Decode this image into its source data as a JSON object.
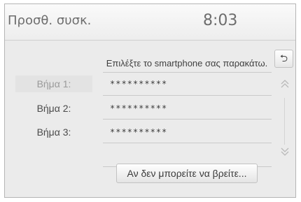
{
  "header": {
    "title": "Προσθ. συσκ.",
    "clock": "8:03"
  },
  "instruction": "Επιλέξτε το smartphone σας παρακάτω.",
  "back_icon_glyph": "⮌",
  "steps": [
    {
      "label": "Βήμα 1:",
      "value": "**********",
      "active": true
    },
    {
      "label": "Βήμα 2:",
      "value": "**********",
      "active": false
    },
    {
      "label": "Βήμα 3:",
      "value": "**********",
      "active": false
    }
  ],
  "scroll": {
    "up_icon": "chevron-double-up-icon",
    "down_icon": "chevron-double-down-icon"
  },
  "find_button_label": "Αν δεν μπορείτε να βρείτε..."
}
